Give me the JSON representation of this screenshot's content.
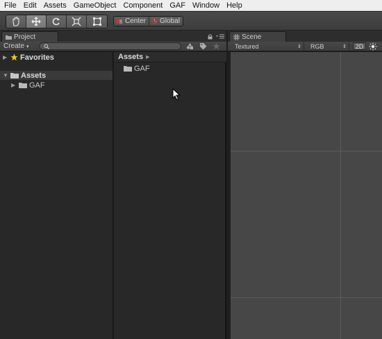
{
  "menubar": {
    "items": [
      {
        "label": "File"
      },
      {
        "label": "Edit"
      },
      {
        "label": "Assets"
      },
      {
        "label": "GameObject"
      },
      {
        "label": "Component"
      },
      {
        "label": "GAF"
      },
      {
        "label": "Window"
      },
      {
        "label": "Help"
      }
    ]
  },
  "toolbar": {
    "tools": [
      "hand-tool",
      "move-tool",
      "rotate-tool",
      "scale-tool",
      "rect-tool"
    ],
    "active_tool": "move-tool",
    "pivot_mode": "Center",
    "pivot_rotation": "Global"
  },
  "project": {
    "tab_label": "Project",
    "create_label": "Create",
    "search_placeholder": "",
    "favorites_label": "Favorites",
    "assets_label": "Assets",
    "tree_child": "GAF",
    "breadcrumb": "Assets",
    "folder_items": [
      "GAF"
    ]
  },
  "scene": {
    "tab_label": "Scene",
    "draw_mode": "Textured",
    "render_mode": "RGB",
    "two_d_label": "2D"
  },
  "colors": {
    "panel_bg": "#282828",
    "viewport_bg": "#474747",
    "menubar_bg": "#eeeeee"
  }
}
